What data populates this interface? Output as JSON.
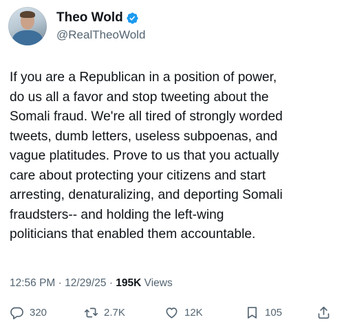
{
  "author": {
    "display_name": "Theo Wold",
    "handle": "@RealTheoWold",
    "verified_icon": "verified-badge-icon",
    "verified_color": "#1d9bf0"
  },
  "tweet": {
    "text": "If you are a Republican in a position of power,\ndo us all a favor and stop tweeting about the\nSomali fraud. We're all tired of strongly worded\ntweets, dumb letters, useless subpoenas, and\nvague platitudes. Prove to us that you actually\ncare about protecting your citizens and start\narresting, denaturalizing, and deporting Somali\nfraudsters-- and holding the left-wing\npoliticians that enabled them accountable.",
    "time": "12:56 PM",
    "date": "12/29/25",
    "separator": "·",
    "views_count": "195K",
    "views_label": "Views"
  },
  "actions": {
    "reply": {
      "icon": "reply-icon",
      "count": "320"
    },
    "repost": {
      "icon": "repost-icon",
      "count": "2.7K"
    },
    "like": {
      "icon": "heart-icon",
      "count": "12K"
    },
    "bookmark": {
      "icon": "bookmark-icon",
      "count": "105"
    },
    "share": {
      "icon": "share-icon"
    }
  },
  "colors": {
    "text": "#0f1419",
    "secondary": "#536471",
    "background": "#ffffff"
  }
}
